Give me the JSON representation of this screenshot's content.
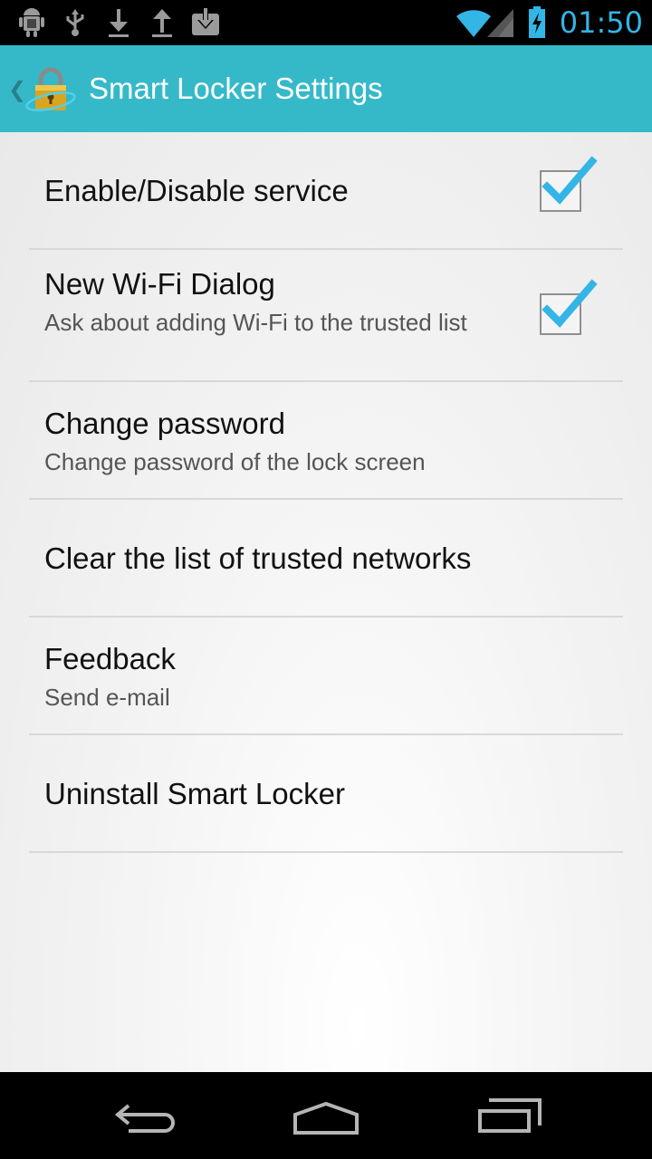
{
  "status_bar": {
    "time": "01:50",
    "icons": [
      "android-debug-icon",
      "usb-icon",
      "download-icon",
      "upload-icon",
      "download-box-icon",
      "wifi-icon",
      "signal-icon",
      "battery-charging-icon"
    ],
    "accent_color": "#33b5e5"
  },
  "action_bar": {
    "title": "Smart Locker Settings",
    "up_glyph": "❮",
    "background_color": "#35b9c9",
    "logo_icon": "padlock-icon"
  },
  "preferences": [
    {
      "title": "Enable/Disable service",
      "summary": "",
      "checked": true
    },
    {
      "title": "New Wi-Fi Dialog",
      "summary": "Ask about adding Wi-Fi to the trusted list",
      "checked": true
    },
    {
      "title": "Change password",
      "summary": "Change password of the lock screen"
    },
    {
      "title": "Clear the list of trusted networks",
      "summary": ""
    },
    {
      "title": "Feedback",
      "summary": "Send e-mail"
    },
    {
      "title": "Uninstall Smart Locker",
      "summary": ""
    }
  ],
  "navigation_bar": {
    "buttons": [
      "back-icon",
      "home-icon",
      "recent-apps-icon"
    ]
  }
}
